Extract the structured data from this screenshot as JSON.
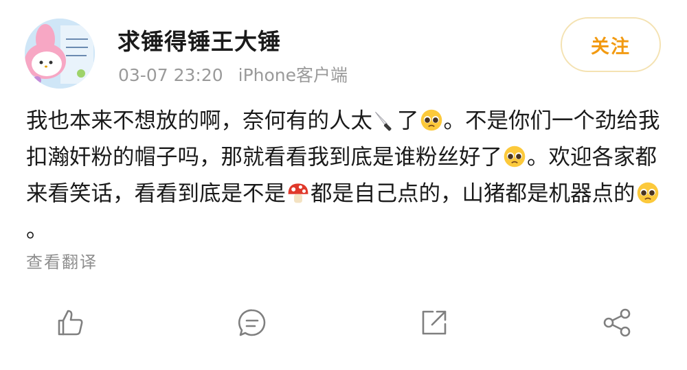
{
  "post": {
    "author": "求锤得锤王大锤",
    "date": "03-07 23:20",
    "source": "iPhone客户端",
    "follow_label": "关注",
    "text": {
      "seg1": "我也本来不想放的啊，奈何有的人太",
      "seg2": "了",
      "seg3": "。不是你们一个劲给我扣瀚奸粉的帽子吗，那就看看我到底是谁粉丝好了",
      "seg4": "。欢迎各家都来看笑话，看看到底是不是",
      "seg5": "都是自己点的，山猪都是机器点的",
      "seg6": "。"
    },
    "translate_label": "查看翻译"
  },
  "emojis": [
    "knife-emoji",
    "pleading-face-emoji",
    "mushroom-emoji"
  ],
  "actions": [
    "like-icon",
    "comment-icon",
    "repost-icon",
    "share-icon"
  ],
  "colors": {
    "accent": "#f29a11",
    "follow_border": "#f4e2b2",
    "meta_text": "#9a9a9a",
    "icon": "#7f7f7f"
  }
}
